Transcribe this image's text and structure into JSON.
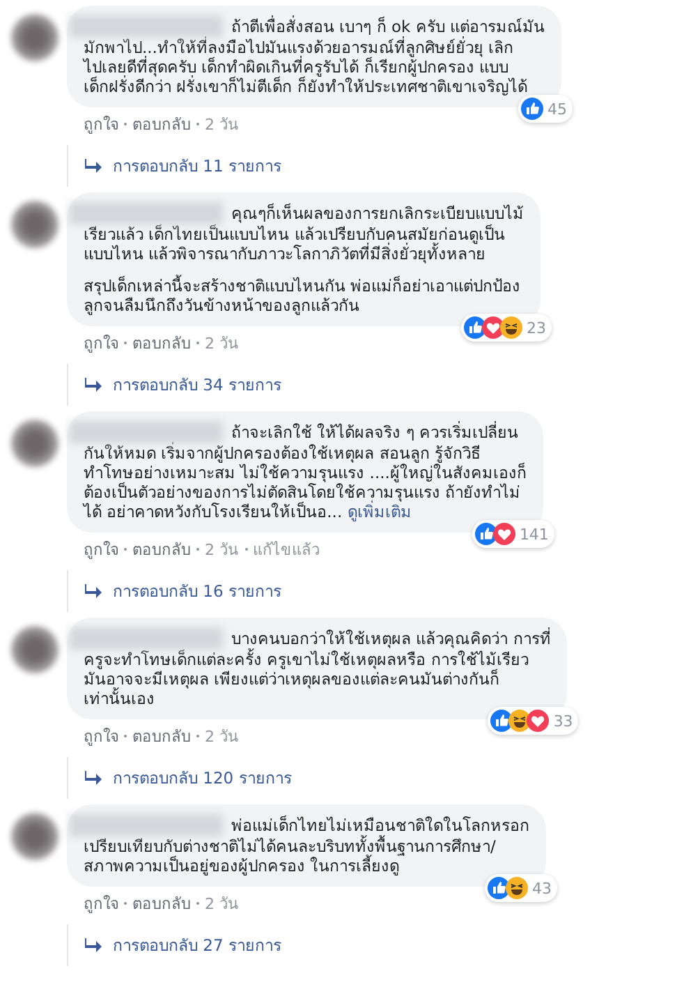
{
  "comments": [
    {
      "paragraphs": [
        "ถ้าตีเพื่อสั่งสอน เบาๆ ก็ ok ครับ แต่อารมณ์มัน\nมักพาไป...ทำให้ที่ลงมือไปมันแรงด้วยอารมณ์ที่ลูกศิษย์ยั่วยุ เลิก\nไปเลยดีที่สุดครับ เด็กทำผิดเกินที่ครูรับได้ ก็เรียกผู้ปกครอง แบบ\nเด็กฝรั่งดีกว่า ฝรั่งเขาก็ไม่ตีเด็ก ก็ยังทำให้ประเทศชาติเขาเจริญได้"
      ],
      "reactions": [
        {
          "kind": "like"
        }
      ],
      "reaction_count": "45",
      "actions": [
        "ถูกใจ",
        "ตอบกลับ",
        "2 วัน"
      ],
      "replies": "การตอบกลับ 11 รายการ"
    },
    {
      "paragraphs": [
        "คุณๆก็เห็นผลของการยกเลิกระเบียบแบบไม้\nเรียวแล้ว เด็กไทยเป็นแบบไหน แล้วเปรียบกับคนสมัยก่อนดูเป็น\nแบบไหน แล้วพิจารณากับภาวะโลกาภิวัตที่มีสิ่งยั่วยุทั้งหลาย",
        "สรุปเด็กเหล่านี้จะสร้างชาติแบบไหนกัน พ่อแม่ก็อย่าเอาแต่ปกป้อง\nลูกจนลืมนึกถึงวันข้างหน้าของลูกแล้วกัน"
      ],
      "reactions": [
        {
          "kind": "like"
        },
        {
          "kind": "love"
        },
        {
          "kind": "haha"
        }
      ],
      "reaction_count": "23",
      "actions": [
        "ถูกใจ",
        "ตอบกลับ",
        "2 วัน"
      ],
      "replies": "การตอบกลับ 34 รายการ"
    },
    {
      "paragraphs": [
        "ถ้าจะเลิกใช้ ให้ได้ผลจริง ๆ ควรเริ่มเปลี่ยน\nกันให้หมด เริ่มจากผู้ปกครองต้องใช้เหตุผล สอนลูก รู้จักวิธี\nทำโทษอย่างเหมาะสม ไม่ใช้ความรุนแรง ....ผู้ใหญ่ในสังคมเองก็\nต้องเป็นตัวอย่างของการไม่ตัดสินโดยใช้ความรุนแรง ถ้ายังทำไม่\nได้ อย่าคาดหวังกับโรงเรียนให้เป็นอ..."
      ],
      "see_more": "ดูเพิ่มเติม",
      "reactions": [
        {
          "kind": "like"
        },
        {
          "kind": "love"
        }
      ],
      "reaction_count": "141",
      "actions": [
        "ถูกใจ",
        "ตอบกลับ",
        "2 วัน",
        "แก้ไขแล้ว"
      ],
      "replies": "การตอบกลับ 16 รายการ"
    },
    {
      "paragraphs": [
        "บางคนบอกว่าให้ใช้เหตุผล แล้วคุณคิดว่า การที่\nครูจะทำโทษเด็กแต่ละครั้ง ครูเขาไม่ใช้เหตุผลหรือ การใช้ไม้เรียว\nมันอาจจะมีเหตุผล เพียงแต่ว่าเหตุผลของแต่ละคนมันต่างกันก็\nเท่านั้นเอง"
      ],
      "reactions": [
        {
          "kind": "like"
        },
        {
          "kind": "haha"
        },
        {
          "kind": "love"
        }
      ],
      "reaction_count": "33",
      "actions": [
        "ถูกใจ",
        "ตอบกลับ",
        "2 วัน"
      ],
      "replies": "การตอบกลับ 120 รายการ"
    },
    {
      "paragraphs": [
        "พ่อแม่เด็กไทยไม่เหมือนชาติใดในโลกหรอก\nเปรียบเทียบกับต่างชาติไม่ได้คนละบริบททั้งพื้นฐานการศึกษา/\nสภาพความเป็นอยู่ของผู้ปกครอง ในการเลี้ยงดู"
      ],
      "reactions": [
        {
          "kind": "like"
        },
        {
          "kind": "haha"
        }
      ],
      "reaction_count": "43",
      "actions": [
        "ถูกใจ",
        "ตอบกลับ",
        "2 วัน"
      ],
      "replies": "การตอบกลับ 27 รายการ"
    }
  ]
}
